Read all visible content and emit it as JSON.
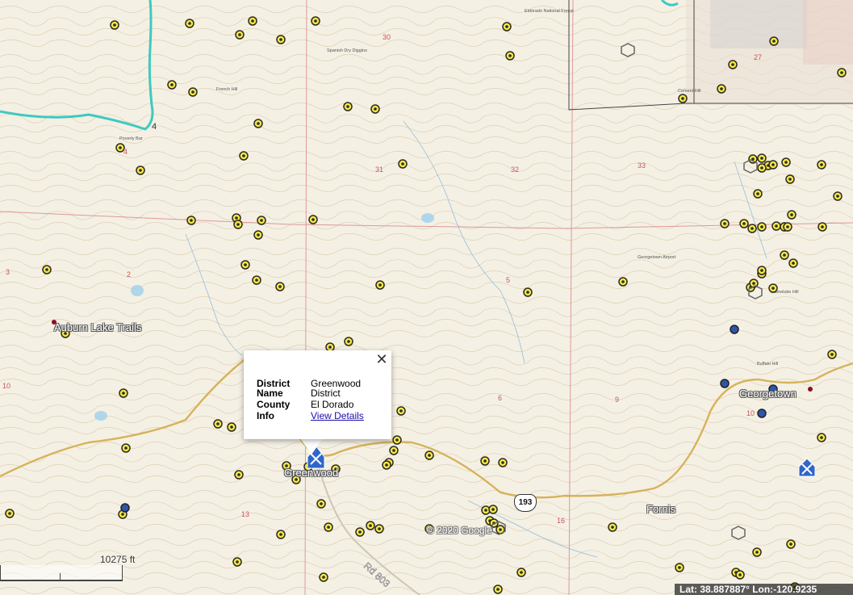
{
  "map": {
    "places": [
      {
        "name": "Auburn Lake Trails"
      },
      {
        "name": "Greenwood"
      },
      {
        "name": "Georgetown"
      },
      {
        "name": "Fornis"
      }
    ],
    "route_shield": "193",
    "road_label": "Rd 803",
    "section_numbers": [
      "30",
      "31",
      "32",
      "33",
      "27",
      "4",
      "5",
      "6",
      "9",
      "10",
      "13",
      "16",
      "2",
      "3"
    ],
    "small_labels": [
      "Eldorado National Forest",
      "Spanish Dry Diggins",
      "French Hill",
      "Cement Hill",
      "Poverty Bar",
      "Mameluke Hill",
      "Buffalo Hill",
      "Georgetown Airport"
    ],
    "colors": {
      "claim_yellow": "#f2e64a",
      "claim_dark": "#2b2b1f",
      "claim_blue": "#2f55a8",
      "river": "#3fc9c0",
      "section_line": "#d9838a",
      "road": "#d7b25a"
    }
  },
  "popup": {
    "close_icon": "close-icon",
    "rows": [
      {
        "key": "District Name",
        "value": "Greenwood District"
      },
      {
        "key": "County",
        "value": "El Dorado"
      },
      {
        "key": "Info",
        "value": "View Details"
      }
    ]
  },
  "copyright": "© 2020 Google",
  "scale": {
    "label": "10275 ft"
  },
  "status": {
    "text": "Lat: 38.887887° Lon:-120.9235"
  }
}
